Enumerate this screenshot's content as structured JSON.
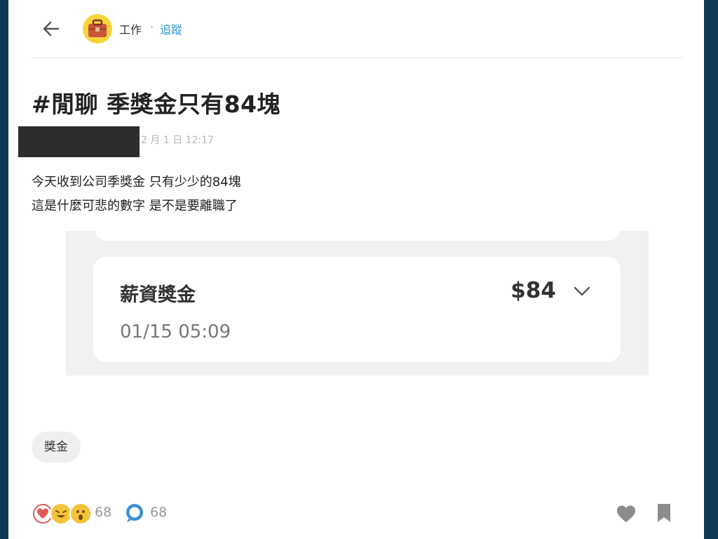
{
  "header": {
    "board_name": "工作",
    "separator": "·",
    "follow_label": "追蹤",
    "back_icon": "arrow-left-icon",
    "board_icon": "briefcase-icon"
  },
  "post": {
    "title": "#閒聊 季獎金只有84塊",
    "meta": "2 月 1 日 12:17",
    "body_lines": [
      "今天收到公司季獎金 只有少少的84塊",
      "這是什麼可悲的數字 是不是要離職了"
    ]
  },
  "screenshot": {
    "label": "薪資獎金",
    "amount": "$84",
    "timestamp": "01/15 05:09"
  },
  "tags": [
    "獎金"
  ],
  "footer": {
    "reaction_count": "68",
    "comment_count": "68",
    "reaction_icons": [
      "heart-icon",
      "laugh-icon",
      "surprised-icon"
    ]
  },
  "colors": {
    "accent": "#3397cf",
    "frame": "#0e3a57",
    "board_avatar": "#f7d438"
  }
}
